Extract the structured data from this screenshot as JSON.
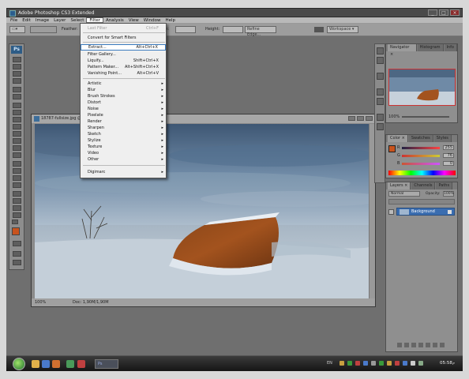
{
  "titlebar": {
    "title": "Adobe Photoshop CS3 Extended"
  },
  "menubar": {
    "items": [
      "File",
      "Edit",
      "Image",
      "Layer",
      "Select",
      "Filter",
      "Analysis",
      "View",
      "Window",
      "Help"
    ],
    "active": "Filter"
  },
  "options": {
    "feather_label": "Feather:",
    "width_label": "Width:",
    "height_label": "Height:",
    "refine_edge": "Refine Edge...",
    "workspace": "Workspace ▾"
  },
  "filter_menu": {
    "last_filter": {
      "label": "Last Filter",
      "shortcut": "Ctrl+F"
    },
    "convert": "Convert for Smart Filters",
    "extract": {
      "label": "Extract...",
      "shortcut": "Alt+Ctrl+X"
    },
    "gallery": {
      "label": "Filter Gallery..."
    },
    "liquify": {
      "label": "Liquify...",
      "shortcut": "Shift+Ctrl+X"
    },
    "pattern": {
      "label": "Pattern Maker...",
      "shortcut": "Alt+Shift+Ctrl+X"
    },
    "vanishing": {
      "label": "Vanishing Point...",
      "shortcut": "Alt+Ctrl+V"
    },
    "submenus": [
      "Artistic",
      "Blur",
      "Brush Strokes",
      "Distort",
      "Noise",
      "Pixelate",
      "Render",
      "Sharpen",
      "Sketch",
      "Stylize",
      "Texture",
      "Video",
      "Other"
    ],
    "digimarc": "Digimarc"
  },
  "document": {
    "title": "18787-fullsize.jpg @",
    "zoom": "100%",
    "doc_size": "Doc: 1,90M/1,90M"
  },
  "navigator": {
    "tabs": [
      "Navigator ×",
      "Histogram",
      "Info"
    ],
    "zoom": "100%"
  },
  "color_panel": {
    "tabs": [
      "Color ×",
      "Swatches",
      "Styles"
    ],
    "channels": [
      {
        "label": "R",
        "value": "255"
      },
      {
        "label": "G",
        "value": "76"
      },
      {
        "label": "B",
        "value": "0"
      }
    ],
    "fg_color": "#c8531d"
  },
  "layers_panel": {
    "tabs": [
      "Layers ×",
      "Channels",
      "Paths"
    ],
    "blend": "Normal",
    "opacity_label": "Opacity:",
    "opacity": "100%",
    "layer_name": "Background"
  },
  "taskbar": {
    "ps_task": "Ps",
    "lang": "EN",
    "clock": "05:58",
    "ampm": "م"
  },
  "colors": {
    "accent": "#3b7bbf",
    "boat": "#b65a26",
    "sky": "#6f8fb2",
    "snow": "#e8eef4"
  }
}
